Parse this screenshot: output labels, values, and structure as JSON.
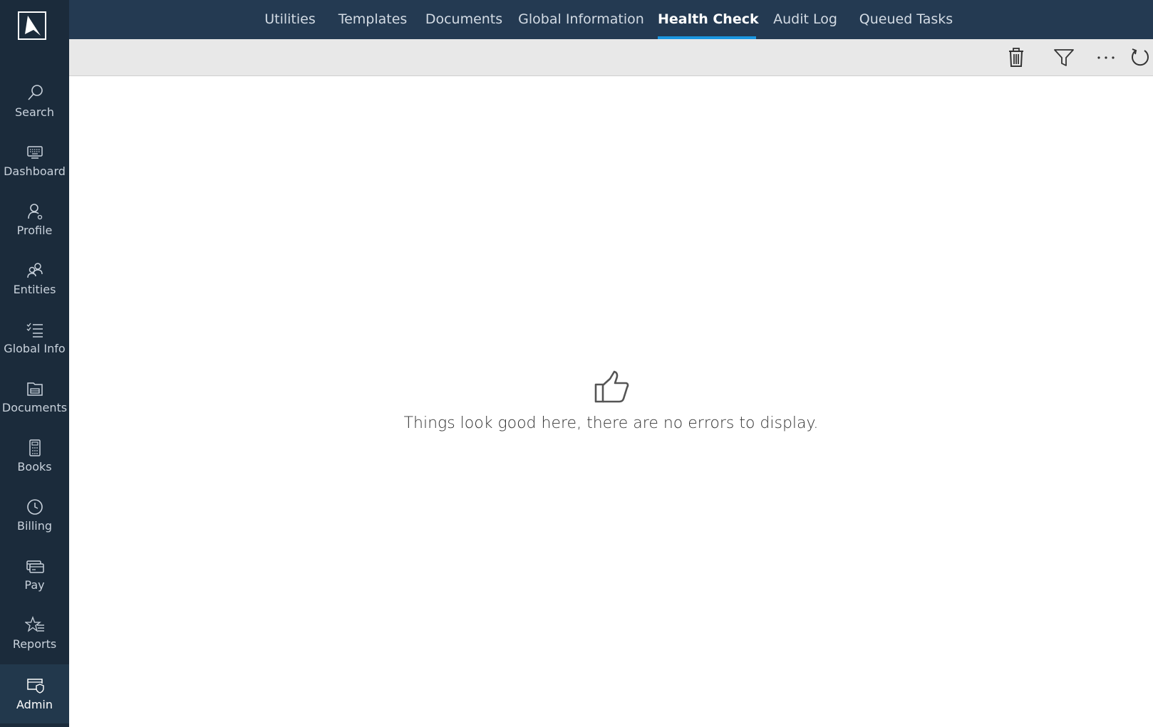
{
  "tabs": [
    {
      "label": "Utilities",
      "active": false
    },
    {
      "label": "Templates",
      "active": false
    },
    {
      "label": "Documents",
      "active": false
    },
    {
      "label": "Global Information",
      "active": false
    },
    {
      "label": "Health Check",
      "active": true
    },
    {
      "label": "Audit Log",
      "active": false
    },
    {
      "label": "Queued Tasks",
      "active": false
    }
  ],
  "sidebar": {
    "logo_icon": "logo-icon",
    "items": [
      {
        "label": "Search",
        "icon": "search-icon",
        "active": false
      },
      {
        "label": "Dashboard",
        "icon": "keyboard-icon",
        "active": false
      },
      {
        "label": "Profile",
        "icon": "user-icon",
        "active": false
      },
      {
        "label": "Entities",
        "icon": "users-icon",
        "active": false
      },
      {
        "label": "Global Info",
        "icon": "checklist-icon",
        "active": false
      },
      {
        "label": "Documents",
        "icon": "document-drawer-icon",
        "active": false
      },
      {
        "label": "Books",
        "icon": "calculator-icon",
        "active": false
      },
      {
        "label": "Billing",
        "icon": "clock-icon",
        "active": false
      },
      {
        "label": "Pay",
        "icon": "payment-card-icon",
        "active": false
      },
      {
        "label": "Reports",
        "icon": "star-list-icon",
        "active": false
      },
      {
        "label": "Admin",
        "icon": "admin-shield-icon",
        "active": true
      }
    ]
  },
  "toolbar": {
    "buttons": [
      {
        "name": "delete",
        "icon": "trash-icon"
      },
      {
        "name": "filter",
        "icon": "filter-icon"
      },
      {
        "name": "more",
        "icon": "more-icon"
      },
      {
        "name": "refresh",
        "icon": "refresh-icon"
      }
    ]
  },
  "empty_state": {
    "icon": "thumbs-up-icon",
    "message": "Things look good here, there are no errors to display."
  },
  "colors": {
    "sidebar_bg": "#1b2b3b",
    "topnav_bg": "#243a52",
    "active_tab_underline": "#1a96e0",
    "toolbar_bg": "#e8e8e8"
  }
}
